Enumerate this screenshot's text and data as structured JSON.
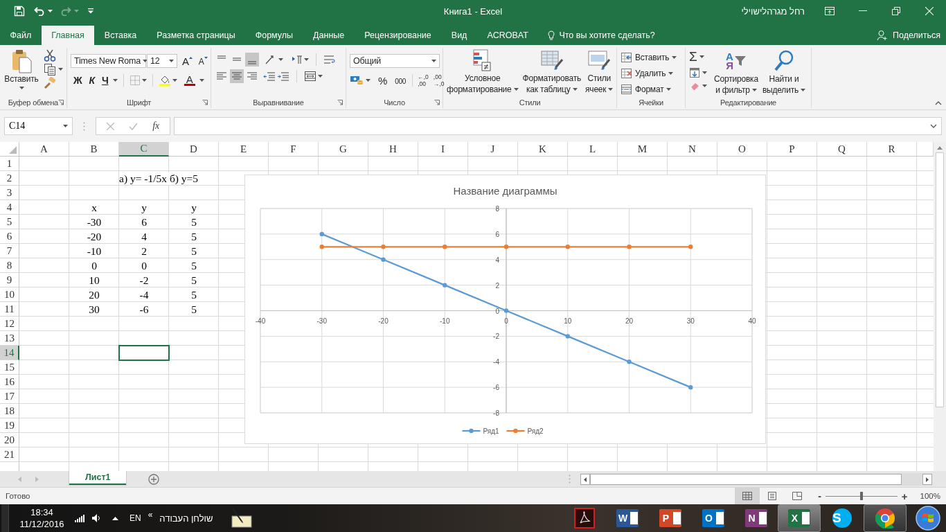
{
  "title_bar": {
    "quick_access": [
      {
        "kind": "save",
        "disabled": false
      },
      {
        "kind": "undo",
        "disabled": false
      },
      {
        "kind": "redo",
        "disabled": true
      },
      {
        "kind": "customize",
        "disabled": false
      }
    ],
    "title": "Книга1  -  Excel",
    "user": "רחל מגרהלישוילי"
  },
  "ribbon_tabs": [
    {
      "label": "Файл",
      "selected": false
    },
    {
      "label": "Главная",
      "selected": true
    },
    {
      "label": "Вставка",
      "selected": false
    },
    {
      "label": "Разметка страницы",
      "selected": false
    },
    {
      "label": "Формулы",
      "selected": false
    },
    {
      "label": "Данные",
      "selected": false
    },
    {
      "label": "Рецензирование",
      "selected": false
    },
    {
      "label": "Вид",
      "selected": false
    },
    {
      "label": "ACROBAT",
      "selected": false
    }
  ],
  "tell_me": "Что вы хотите сделать?",
  "share": "Поделиться",
  "ribbon": {
    "clipboard": {
      "paste": "Вставить",
      "label": "Буфер обмена"
    },
    "font": {
      "name": "Times New Roma",
      "size": "12",
      "grow": "A",
      "shrink": "A",
      "bold": "Ж",
      "italic": "К",
      "underline": "Ч",
      "color_letter": "A",
      "label": "Шрифт"
    },
    "alignment": {
      "vertical": [
        {
          "kind": "top",
          "selected": false
        },
        {
          "kind": "middle",
          "selected": false
        },
        {
          "kind": "bottom",
          "selected": true
        }
      ],
      "horizontal": [
        {
          "kind": "left",
          "selected": false
        },
        {
          "kind": "center",
          "selected": true
        },
        {
          "kind": "right",
          "selected": false
        }
      ],
      "label": "Выравнивание"
    },
    "number": {
      "format": "Общий",
      "percent": "%",
      "thousands": "000",
      "decimals": [
        {
          "lines": [
            "←,0",
            ",00"
          ]
        },
        {
          "lines": [
            ",00",
            "→,0"
          ]
        }
      ],
      "label": "Число"
    },
    "styles": {
      "buttons": [
        {
          "kind": "conditional",
          "lines": [
            "Условное",
            "форматирование"
          ]
        },
        {
          "kind": "table",
          "lines": [
            "Форматировать",
            "как таблицу"
          ]
        },
        {
          "kind": "cell",
          "lines": [
            "Стили",
            "ячеек"
          ]
        }
      ],
      "label": "Стили"
    },
    "cells": {
      "items": [
        {
          "kind": "insert",
          "label": "Вставить"
        },
        {
          "kind": "delete",
          "label": "Удалить"
        },
        {
          "kind": "format",
          "label": "Формат"
        }
      ],
      "label": "Ячейки"
    },
    "editing": {
      "sum": "Σ",
      "sort": {
        "letters": [
          "А",
          "Я"
        ],
        "lines": [
          "Сортировка",
          "и фильтр"
        ]
      },
      "find": {
        "lines": [
          "Найти и",
          "выделить"
        ]
      },
      "label": "Редактирование"
    }
  },
  "formula_bar": {
    "name_box": "C14",
    "function_label": "fx"
  },
  "sheet": {
    "columns": [
      {
        "label": "A",
        "selected": false
      },
      {
        "label": "B",
        "selected": false
      },
      {
        "label": "C",
        "selected": true
      },
      {
        "label": "D",
        "selected": false
      },
      {
        "label": "E",
        "selected": false
      },
      {
        "label": "F",
        "selected": false
      },
      {
        "label": "G",
        "selected": false
      },
      {
        "label": "H",
        "selected": false
      },
      {
        "label": "I",
        "selected": false
      },
      {
        "label": "J",
        "selected": false
      },
      {
        "label": "K",
        "selected": false
      },
      {
        "label": "L",
        "selected": false
      },
      {
        "label": "M",
        "selected": false
      },
      {
        "label": "N",
        "selected": false
      },
      {
        "label": "O",
        "selected": false
      },
      {
        "label": "P",
        "selected": false
      },
      {
        "label": "Q",
        "selected": false
      },
      {
        "label": "R",
        "selected": false
      }
    ],
    "rows": [
      {
        "label": "1",
        "selected": false,
        "cells": {}
      },
      {
        "label": "2",
        "selected": false,
        "cells": {
          "C": "а) y= -1/5x б) y=5"
        }
      },
      {
        "label": "3",
        "selected": false,
        "cells": {}
      },
      {
        "label": "4",
        "selected": false,
        "cells": {
          "B": "x",
          "C": "y",
          "D": "y"
        }
      },
      {
        "label": "5",
        "selected": false,
        "cells": {
          "B": "-30",
          "C": "6",
          "D": "5"
        }
      },
      {
        "label": "6",
        "selected": false,
        "cells": {
          "B": "-20",
          "C": "4",
          "D": "5"
        }
      },
      {
        "label": "7",
        "selected": false,
        "cells": {
          "B": "-10",
          "C": "2",
          "D": "5"
        }
      },
      {
        "label": "8",
        "selected": false,
        "cells": {
          "B": "0",
          "C": "0",
          "D": "5"
        }
      },
      {
        "label": "9",
        "selected": false,
        "cells": {
          "B": "10",
          "C": "-2",
          "D": "5"
        }
      },
      {
        "label": "10",
        "selected": false,
        "cells": {
          "B": "20",
          "C": "-4",
          "D": "5"
        }
      },
      {
        "label": "11",
        "selected": false,
        "cells": {
          "B": "30",
          "C": "-6",
          "D": "5"
        }
      },
      {
        "label": "12",
        "selected": false,
        "cells": {}
      },
      {
        "label": "13",
        "selected": false,
        "cells": {}
      },
      {
        "label": "14",
        "selected": true,
        "cells": {}
      },
      {
        "label": "15",
        "selected": false,
        "cells": {}
      },
      {
        "label": "16",
        "selected": false,
        "cells": {}
      },
      {
        "label": "17",
        "selected": false,
        "cells": {}
      },
      {
        "label": "18",
        "selected": false,
        "cells": {}
      },
      {
        "label": "19",
        "selected": false,
        "cells": {}
      },
      {
        "label": "20",
        "selected": false,
        "cells": {}
      },
      {
        "label": "21",
        "selected": false,
        "cells": {}
      }
    ],
    "chart": {
      "chart_data": {
        "type": "line",
        "title": "Название диаграммы",
        "x": [
          -30,
          -20,
          -10,
          0,
          10,
          20,
          30
        ],
        "series": [
          {
            "name": "Ряд1",
            "color": "#5b9bd5",
            "marker": true,
            "values": [
              6,
              4,
              2,
              0,
              -2,
              -4,
              -6
            ]
          },
          {
            "name": "Ряд2",
            "color": "#ed7d31",
            "marker": true,
            "values": [
              5,
              5,
              5,
              5,
              5,
              5,
              5
            ]
          }
        ],
        "xlim": [
          -40,
          40
        ],
        "ylim": [
          -8,
          8
        ],
        "grid": true,
        "legend": "bottom",
        "xticks": [
          {
            "value": -40,
            "label": "-40"
          },
          {
            "value": -30,
            "label": "-30"
          },
          {
            "value": -20,
            "label": "-20"
          },
          {
            "value": -10,
            "label": "-10"
          },
          {
            "value": 0,
            "label": "0"
          },
          {
            "value": 10,
            "label": "10"
          },
          {
            "value": 20,
            "label": "20"
          },
          {
            "value": 30,
            "label": "30"
          },
          {
            "value": 40,
            "label": "40"
          }
        ],
        "yticks": [
          {
            "value": -8,
            "label": "-8"
          },
          {
            "value": -6,
            "label": "-6"
          },
          {
            "value": -4,
            "label": "-4"
          },
          {
            "value": -2,
            "label": "-2"
          },
          {
            "value": 0,
            "label": "0"
          },
          {
            "value": 2,
            "label": "2"
          },
          {
            "value": 4,
            "label": "4"
          },
          {
            "value": 6,
            "label": "6"
          },
          {
            "value": 8,
            "label": "8"
          }
        ]
      }
    }
  },
  "sheet_tabs": [
    {
      "label": "Лист1",
      "selected": true
    }
  ],
  "status_bar": {
    "status": "Готово",
    "views": [
      {
        "kind": "normal",
        "selected": true
      },
      {
        "kind": "page_layout",
        "selected": false
      },
      {
        "kind": "page_break",
        "selected": false
      }
    ],
    "zoom": {
      "minus": "-",
      "plus": "+",
      "level": 0.5,
      "reading": "100%"
    }
  },
  "taskbar": {
    "time": "18:34",
    "date": "11/12/2016",
    "language": "EN",
    "chevron": "«",
    "toolbar": "שולחן העבודה",
    "apps": [
      {
        "kind": "acrobat",
        "running": false,
        "selected": false
      },
      {
        "kind": "word",
        "letter": "W",
        "running": false,
        "selected": false
      },
      {
        "kind": "powerpoint",
        "letter": "P",
        "running": false,
        "selected": false
      },
      {
        "kind": "outlook",
        "letter": "O",
        "running": false,
        "selected": false
      },
      {
        "kind": "onenote",
        "letter": "N",
        "running": false,
        "selected": false
      },
      {
        "kind": "excel",
        "letter": "X",
        "running": true,
        "selected": true
      },
      {
        "kind": "skype",
        "letter": "S",
        "running": false,
        "selected": false
      },
      {
        "kind": "chrome",
        "running": true,
        "selected": false
      }
    ]
  }
}
